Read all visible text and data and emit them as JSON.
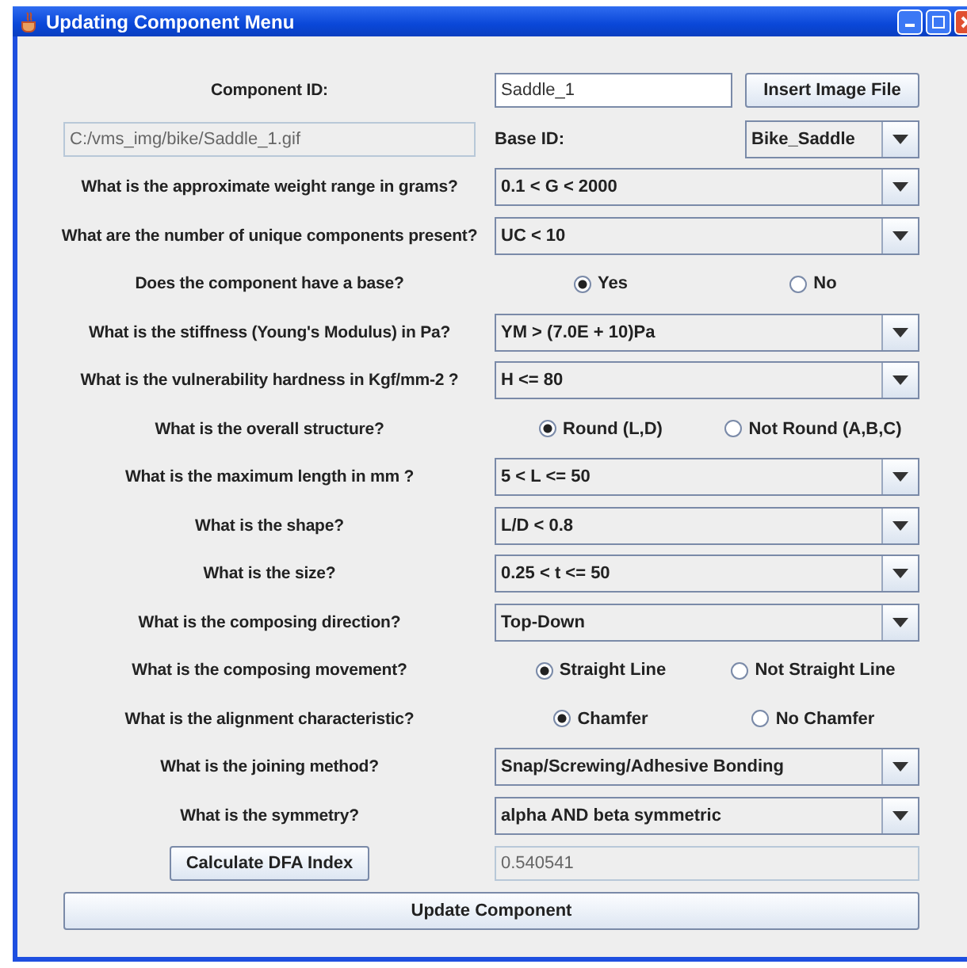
{
  "window": {
    "title": "Updating Component Menu"
  },
  "component_id": {
    "label": "Component ID:",
    "value": "Saddle_1"
  },
  "insert_button": "Insert Image File",
  "image_path": {
    "value": "C:/vms_img/bike/Saddle_1.gif"
  },
  "base_id": {
    "label": "Base ID:",
    "value": "Bike_Saddle"
  },
  "questions": [
    {
      "kind": "select",
      "label": "What is the approximate weight range in grams?",
      "value": "0.1 < G < 2000"
    },
    {
      "kind": "select",
      "label": "What are the number of unique components present?",
      "value": "UC < 10"
    },
    {
      "kind": "radio",
      "label": "Does the component have a base?",
      "options": [
        {
          "label": "Yes",
          "selected": true
        },
        {
          "label": "No",
          "selected": false
        }
      ]
    },
    {
      "kind": "select",
      "label": "What is the stiffness (Young's Modulus) in Pa?",
      "value": "YM > (7.0E + 10)Pa"
    },
    {
      "kind": "select",
      "label": "What is the vulnerability hardness in Kgf/mm-2 ?",
      "value": "H <= 80"
    },
    {
      "kind": "radio",
      "label": "What is the overall structure?",
      "options": [
        {
          "label": "Round (L,D)",
          "selected": true
        },
        {
          "label": "Not Round (A,B,C)",
          "selected": false
        }
      ]
    },
    {
      "kind": "select",
      "label": "What is the maximum length in mm ?",
      "value": "5 < L <= 50"
    },
    {
      "kind": "select",
      "label": "What is the shape?",
      "value": "L/D < 0.8"
    },
    {
      "kind": "select",
      "label": "What is the size?",
      "value": "0.25 < t <= 50"
    },
    {
      "kind": "select",
      "label": "What is the composing direction?",
      "value": "Top-Down"
    },
    {
      "kind": "radio",
      "label": "What is the composing movement?",
      "options": [
        {
          "label": "Straight Line",
          "selected": true
        },
        {
          "label": "Not Straight Line",
          "selected": false
        }
      ]
    },
    {
      "kind": "radio",
      "label": "What is the alignment characteristic?",
      "options": [
        {
          "label": "Chamfer",
          "selected": true
        },
        {
          "label": "No Chamfer",
          "selected": false
        }
      ]
    },
    {
      "kind": "select",
      "label": "What is the joining method?",
      "value": "Snap/Screwing/Adhesive Bonding"
    },
    {
      "kind": "select",
      "label": "What is the symmetry?",
      "value": "alpha AND beta symmetric"
    }
  ],
  "calculate_button": "Calculate DFA Index",
  "dfa_index": {
    "value": "0.540541"
  },
  "update_button": "Update Component"
}
